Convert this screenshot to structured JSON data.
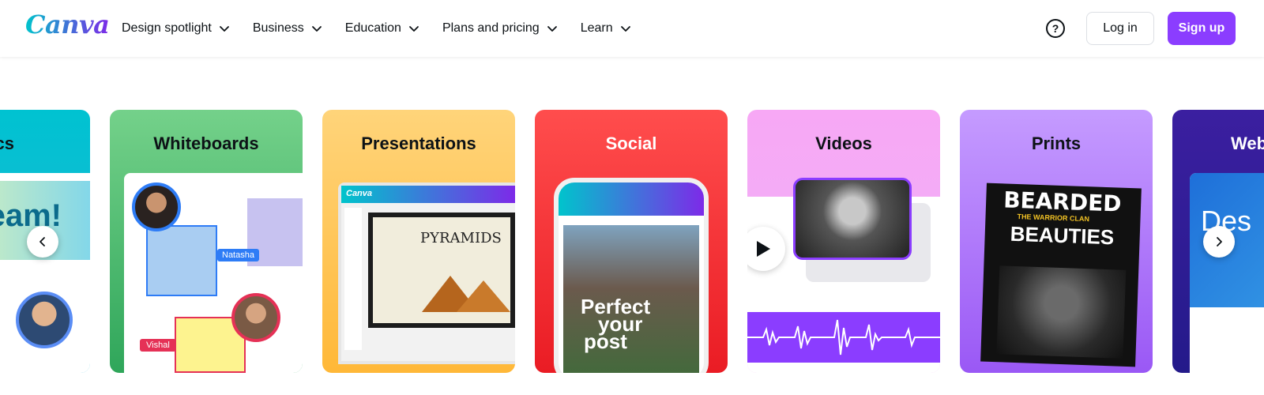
{
  "header": {
    "logo": "Canva",
    "nav": [
      {
        "label": "Design spotlight"
      },
      {
        "label": "Business"
      },
      {
        "label": "Education"
      },
      {
        "label": "Plans and pricing"
      },
      {
        "label": "Learn"
      }
    ],
    "help_symbol": "?",
    "login_label": "Log in",
    "signup_label": "Sign up"
  },
  "cards": {
    "graphics": {
      "title": "cs",
      "preview_text": "eam!"
    },
    "whiteboards": {
      "title": "Whiteboards",
      "tag_natasha": "Natasha",
      "tag_vishal": "Vishal"
    },
    "presentations": {
      "title": "Presentations",
      "app_name": "Canva",
      "slide_text": "PYRAMIDS"
    },
    "social": {
      "title": "Social",
      "post_text_1": "Perfect",
      "post_text_2": "your",
      "post_text_3": "post"
    },
    "videos": {
      "title": "Videos"
    },
    "prints": {
      "title": "Prints",
      "poster_line_1": "BEARDED",
      "poster_line_2": "THE WARRIOR CLAN",
      "poster_line_3": "BEAUTIES"
    },
    "websites": {
      "title": "Web",
      "preview_text": "Des"
    }
  },
  "colors": {
    "brand_purple": "#8b3dff",
    "graphics_bg": "#00c2d1",
    "whiteboards_bg": "#4fbd6e",
    "presentations_bg": "#ffc655",
    "social_bg": "#f3262e",
    "videos_bg": "#f2acf6",
    "prints_bg": "#b07af9",
    "web_bg": "#2e1b94"
  }
}
